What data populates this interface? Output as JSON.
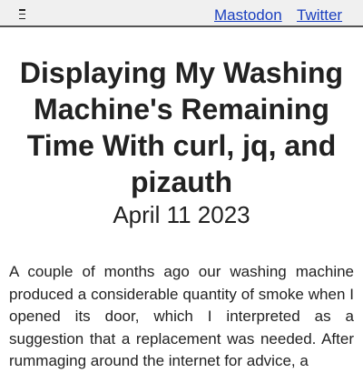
{
  "nav": {
    "menu_icon": "hamburger-menu-icon",
    "links": [
      {
        "label": "Mastodon"
      },
      {
        "label": "Twitter"
      }
    ]
  },
  "article": {
    "title": "Displaying My Washing Machine's Remaining Time With curl, jq, and pizauth",
    "date": "April 11 2023",
    "paragraph": "A couple of months ago our washing machine produced a considerable quantity of smoke when I opened its door, which I interpreted as a suggestion that a replacement was needed. After rummaging around the internet for advice, a"
  },
  "colors": {
    "link": "#1a3fbf",
    "topbar_bg": "#f0f0f0",
    "text": "#222222"
  }
}
